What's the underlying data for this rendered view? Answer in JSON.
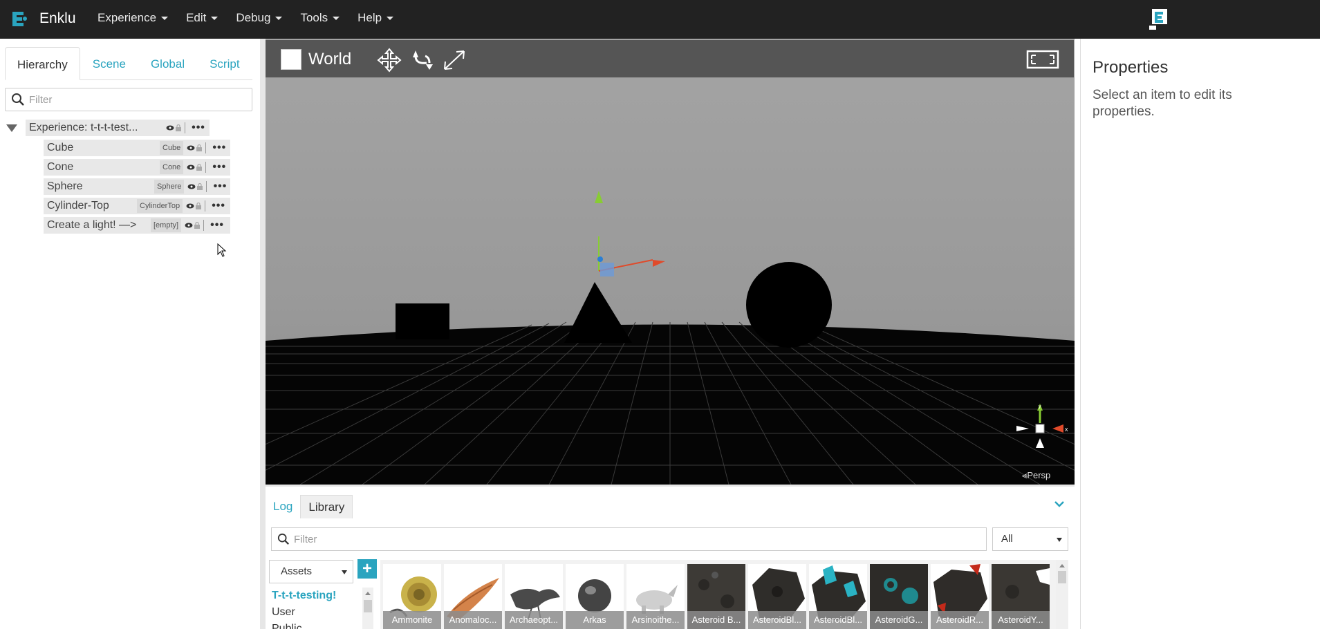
{
  "app": {
    "brand": "Enklu",
    "menu": [
      {
        "label": "Experience"
      },
      {
        "label": "Edit"
      },
      {
        "label": "Debug"
      },
      {
        "label": "Tools"
      },
      {
        "label": "Help"
      }
    ],
    "accent_color": "#2aa4bf"
  },
  "left_panel": {
    "tabs": [
      "Hierarchy",
      "Scene",
      "Global",
      "Script"
    ],
    "active_tab": "Hierarchy",
    "filter_placeholder": "Filter",
    "root": {
      "label": "Experience: t-t-t-test..."
    },
    "children": [
      {
        "label": "Cube",
        "tag": "Cube"
      },
      {
        "label": "Cone",
        "tag": "Cone"
      },
      {
        "label": "Sphere",
        "tag": "Sphere"
      },
      {
        "label": "Cylinder-Top",
        "tag": "CylinderTop"
      },
      {
        "label": "Create a light! —>",
        "tag": "[empty]"
      }
    ]
  },
  "viewport": {
    "space_label": "World",
    "camera_label": "⪡Persp",
    "gizmo_axes": {
      "x": "x",
      "y": "y"
    }
  },
  "bottom_panel": {
    "tabs": [
      "Log",
      "Library"
    ],
    "active_tab": "Library",
    "filter_placeholder": "Filter",
    "type_filter": "All",
    "source_select": "Assets",
    "add_label": "+",
    "categories": [
      "T-t-t-testing!",
      "User",
      "Public"
    ],
    "selected_category": "T-t-t-testing!",
    "assets": [
      {
        "name": "Ammonite",
        "icon": "ammonite-thumbnail"
      },
      {
        "name": "Anomaloc...",
        "icon": "anomalocaris-thumbnail"
      },
      {
        "name": "Archaeopt...",
        "icon": "archaeopteryx-thumbnail"
      },
      {
        "name": "Arkas",
        "icon": "arkas-thumbnail"
      },
      {
        "name": "Arsinoithe...",
        "icon": "arsinoitherium-thumbnail"
      },
      {
        "name": "Asteroid B...",
        "icon": "asteroid-thumbnail"
      },
      {
        "name": "AsteroidBl...",
        "icon": "asteroid-thumbnail"
      },
      {
        "name": "AsteroidBl...",
        "icon": "asteroid-teal-thumbnail"
      },
      {
        "name": "AsteroidG...",
        "icon": "asteroid-teal-thumbnail"
      },
      {
        "name": "AsteroidR...",
        "icon": "asteroid-red-thumbnail"
      },
      {
        "name": "AsteroidY...",
        "icon": "asteroid-thumbnail"
      }
    ]
  },
  "properties": {
    "title": "Properties",
    "message": "Select an item to edit its properties."
  }
}
